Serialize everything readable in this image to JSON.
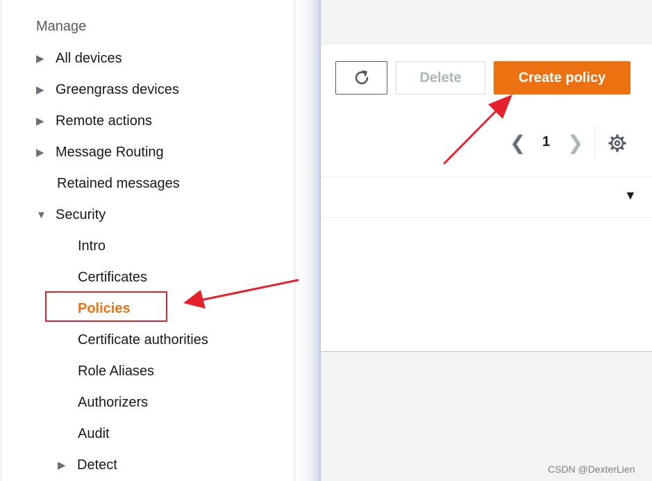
{
  "sidebar": {
    "section_title": "Manage",
    "items": [
      {
        "label": "All devices",
        "caret": "▶"
      },
      {
        "label": "Greengrass devices",
        "caret": "▶"
      },
      {
        "label": "Remote actions",
        "caret": "▶"
      },
      {
        "label": "Message Routing",
        "caret": "▶"
      },
      {
        "label": "Retained messages"
      },
      {
        "label": "Security",
        "caret": "▼"
      },
      {
        "label": "Intro"
      },
      {
        "label": "Certificates"
      },
      {
        "label": "Policies"
      },
      {
        "label": "Certificate authorities"
      },
      {
        "label": "Role Aliases"
      },
      {
        "label": "Authorizers"
      },
      {
        "label": "Audit"
      },
      {
        "label": "Detect",
        "caret": "▶"
      }
    ]
  },
  "toolbar": {
    "delete_label": "Delete",
    "create_label": "Create policy"
  },
  "pager": {
    "prev": "❮",
    "page": "1",
    "next": "❯"
  },
  "table": {
    "sort_caret": "▼"
  },
  "colors": {
    "accent": "#ec7211",
    "annotation": "#e5222b"
  },
  "watermark": "CSDN @DexterLien"
}
